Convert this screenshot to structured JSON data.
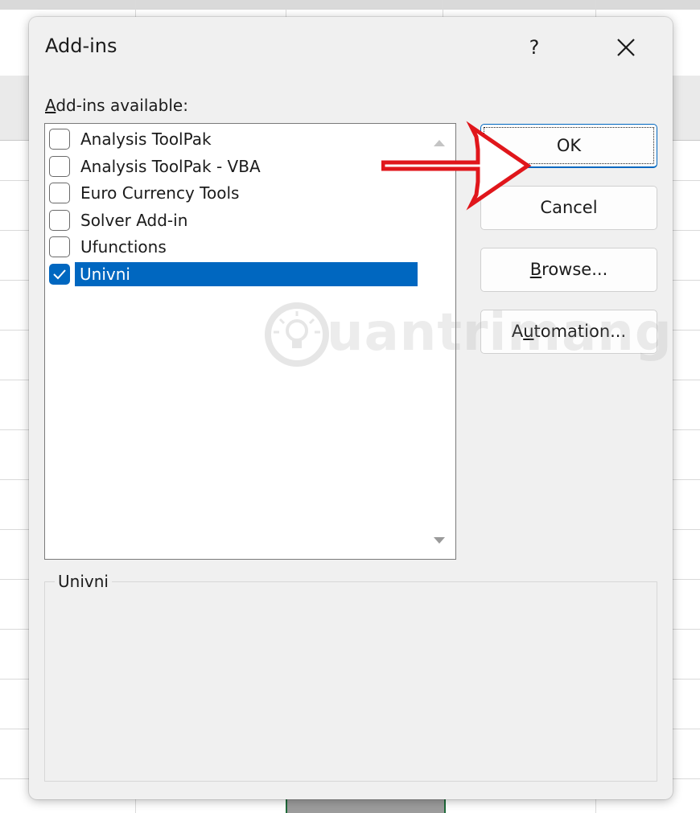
{
  "dialog": {
    "title": "Add-ins",
    "help_label": "?",
    "list_label_accesskey": "A",
    "list_label_rest": "dd-ins available:",
    "addins": [
      {
        "label": "Analysis ToolPak",
        "checked": false
      },
      {
        "label": "Analysis ToolPak - VBA",
        "checked": false
      },
      {
        "label": "Euro Currency Tools",
        "checked": false
      },
      {
        "label": "Solver Add-in",
        "checked": false
      },
      {
        "label": "Ufunctions",
        "checked": false
      },
      {
        "label": "Univni",
        "checked": true,
        "selected": true
      }
    ],
    "buttons": {
      "ok": "OK",
      "cancel": "Cancel",
      "browse_accesskey": "B",
      "browse_rest": "rowse...",
      "automation_pre": "A",
      "automation_accesskey": "u",
      "automation_rest": "tomation..."
    },
    "description_title": "Univni"
  },
  "watermark": {
    "text": "uantrimang"
  },
  "colors": {
    "accent": "#0067c0",
    "dialog_bg": "#f0f0f0",
    "annotation": "#e0161b"
  },
  "icons": {
    "close": "close-icon",
    "check": "check-icon",
    "scroll_up": "scroll-up-arrow-icon",
    "scroll_down": "scroll-down-arrow-icon",
    "annotation": "red-arrow-icon",
    "watermark_logo": "lightbulb-icon"
  }
}
